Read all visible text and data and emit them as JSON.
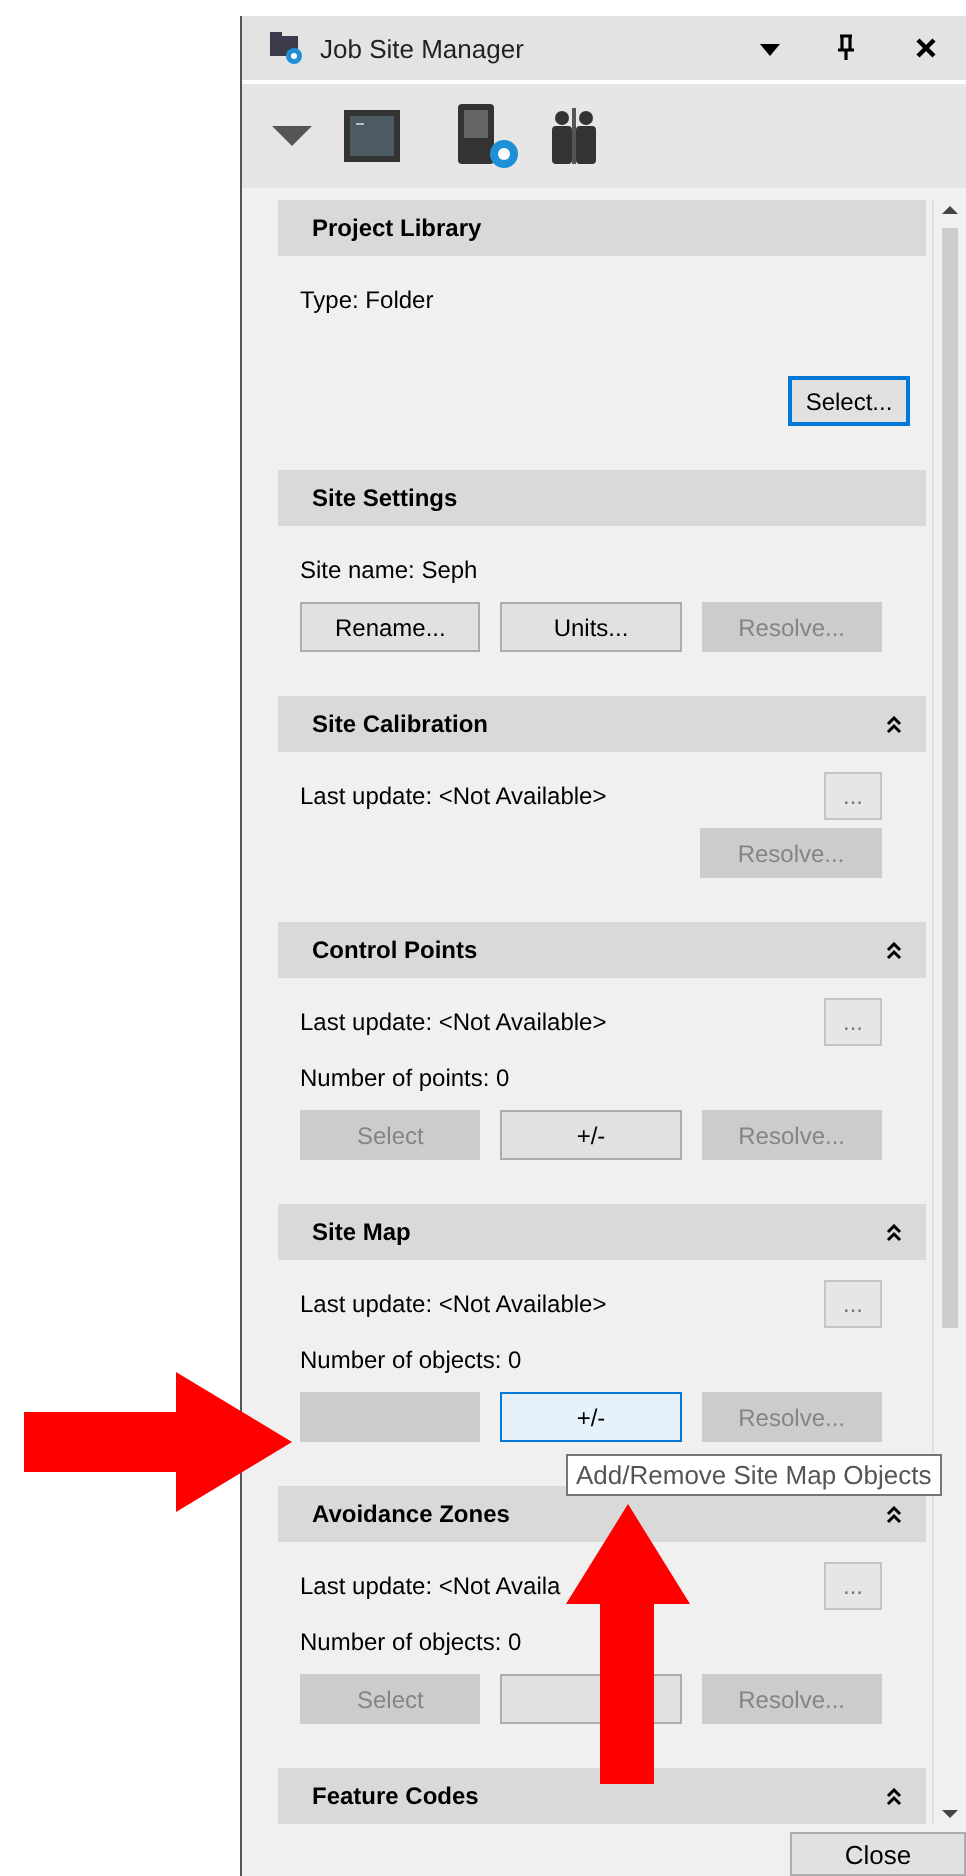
{
  "window": {
    "title": "Job Site Manager"
  },
  "sections": [
    {
      "title": "Project Library",
      "collapsible": false,
      "kind": "picker",
      "lines": [
        {
          "text": "Type: Folder"
        }
      ],
      "buttons": [
        {
          "label": "Select...",
          "disabled": false,
          "focused": true,
          "hovered": false
        }
      ]
    },
    {
      "title": "Site Settings",
      "collapsible": false,
      "kind": "row",
      "lines": [
        {
          "text": "Site name: Seph"
        }
      ],
      "buttons": [
        {
          "label": "Rename...",
          "disabled": false,
          "focused": false,
          "hovered": false
        },
        {
          "label": "Units...",
          "disabled": false,
          "focused": false,
          "hovered": false
        },
        {
          "label": "Resolve...",
          "disabled": true,
          "focused": false,
          "hovered": false
        }
      ]
    },
    {
      "title": "Site Calibration",
      "collapsible": true,
      "kind": "single",
      "lines": [
        {
          "text": "Last update: <Not Available>",
          "more": "..."
        }
      ],
      "buttons": [
        {
          "label": "Resolve...",
          "disabled": true,
          "focused": false,
          "hovered": false
        }
      ]
    },
    {
      "title": "Control Points",
      "collapsible": true,
      "kind": "row",
      "lines": [
        {
          "text": "Last update: <Not Available>",
          "more": "..."
        },
        {
          "text": "Number of points: 0"
        }
      ],
      "buttons": [
        {
          "label": "Select",
          "disabled": true,
          "focused": false,
          "hovered": false
        },
        {
          "label": "+/-",
          "disabled": false,
          "focused": false,
          "hovered": false
        },
        {
          "label": "Resolve...",
          "disabled": true,
          "focused": false,
          "hovered": false
        }
      ]
    },
    {
      "title": "Site Map",
      "collapsible": true,
      "kind": "row",
      "lines": [
        {
          "text": "Last update: <Not Available>",
          "more": "..."
        },
        {
          "text": "Number of objects: 0"
        }
      ],
      "buttons": [
        {
          "disabled": true,
          "focused": false,
          "hovered": false
        },
        {
          "label": "+/-",
          "disabled": false,
          "focused": false,
          "hovered": true
        },
        {
          "label": "Resolve...",
          "disabled": true,
          "focused": false,
          "hovered": false
        }
      ]
    },
    {
      "title": "Avoidance Zones",
      "collapsible": true,
      "kind": "row",
      "lines": [
        {
          "text": "Last update: <Not Availa",
          "more": "..."
        },
        {
          "text": "Number of objects: 0"
        }
      ],
      "buttons": [
        {
          "label": "Select",
          "disabled": true,
          "focused": false,
          "hovered": false
        },
        {
          "disabled": false,
          "focused": false,
          "hovered": false
        },
        {
          "label": "Resolve...",
          "disabled": true,
          "focused": false,
          "hovered": false
        }
      ]
    },
    {
      "title": "Feature Codes",
      "collapsible": true,
      "kind": "header"
    }
  ],
  "close_button": "Close",
  "tooltip": "Add/Remove Site Map Objects",
  "annotations": [
    {
      "kind": "arrow-right"
    },
    {
      "kind": "arrow-up"
    }
  ]
}
